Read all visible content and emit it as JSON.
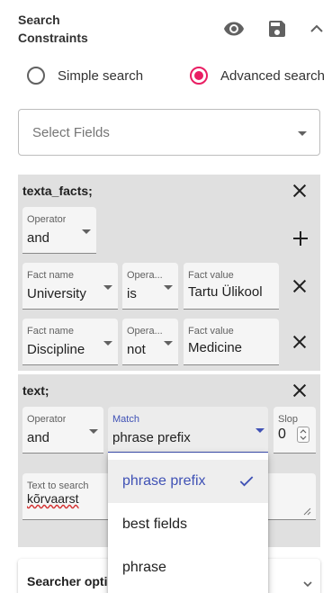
{
  "header": {
    "title_line1": "Search",
    "title_line2": "Constraints",
    "icons": [
      "eye-icon",
      "save-icon",
      "chevron-up-icon"
    ]
  },
  "search_mode": {
    "options": [
      "Simple search",
      "Advanced search"
    ],
    "selected": "Advanced search",
    "accent_color": "#e91e63"
  },
  "select_fields": {
    "placeholder": "Select Fields"
  },
  "facts_panel": {
    "title": "texta_facts;",
    "operator": {
      "label": "Operator",
      "value": "and"
    },
    "rows": [
      {
        "fact_name_label": "Fact name",
        "fact_name": "University",
        "operator_label": "Opera...",
        "operator": "is",
        "value_label": "Fact value",
        "value": "Tartu Ülikool"
      },
      {
        "fact_name_label": "Fact name",
        "fact_name": "Discipline",
        "operator_label": "Opera...",
        "operator": "not",
        "value_label": "Fact value",
        "value": "Medicine"
      }
    ]
  },
  "text_panel": {
    "title": "text;",
    "operator": {
      "label": "Operator",
      "value": "and"
    },
    "match": {
      "label": "Match",
      "value": "phrase prefix"
    },
    "slop": {
      "label": "Slop",
      "value": "0"
    },
    "text_to_search": {
      "label": "Text to search",
      "value": "kõrvaarst"
    }
  },
  "match_menu": {
    "options": [
      "phrase prefix",
      "best fields",
      "phrase"
    ],
    "selected": "phrase prefix",
    "selected_color": "#3f51b5"
  },
  "accordion": {
    "title": "Searcher optio"
  }
}
